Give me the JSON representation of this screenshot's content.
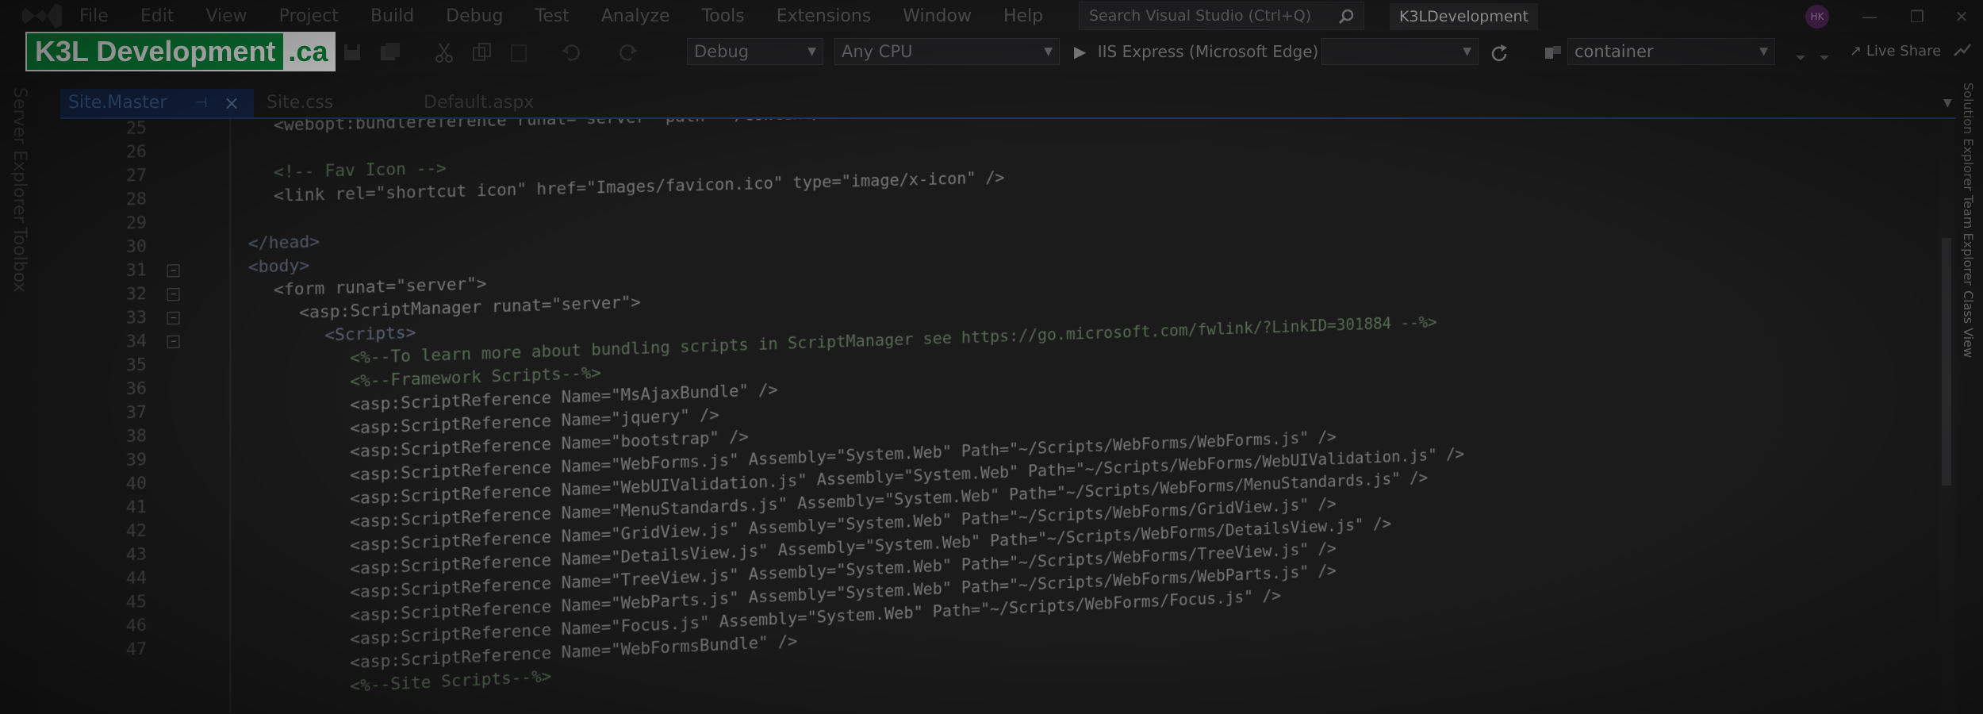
{
  "menu": [
    "File",
    "Edit",
    "View",
    "Project",
    "Build",
    "Debug",
    "Test",
    "Analyze",
    "Tools",
    "Extensions",
    "Window",
    "Help"
  ],
  "search": {
    "placeholder": "Search Visual Studio (Ctrl+Q)"
  },
  "project_title": "K3LDevelopment",
  "user_initials": "HK",
  "logo": {
    "main": "K3L Development",
    "tld": ".ca"
  },
  "toolbar": {
    "config": "Debug",
    "platform": "Any CPU",
    "run_target": "IIS Express (Microsoft Edge)",
    "nav_target": "container",
    "live_share": "Live Share"
  },
  "tabs": [
    {
      "label": "Site.Master",
      "active": true
    },
    {
      "label": "Site.css",
      "active": false
    },
    {
      "label": "Default.aspx",
      "active": false
    }
  ],
  "left_rail": [
    "Server Explorer",
    "Toolbox"
  ],
  "right_rail": [
    "Solution Explorer",
    "Team Explorer",
    "Class View"
  ],
  "code_lines": [
    {
      "n": "25",
      "indent": 2,
      "text": "<webopt:bundlereference runat=\"server\" path=\"~/Content/css\" />"
    },
    {
      "n": "26",
      "indent": 0,
      "text": ""
    },
    {
      "n": "27",
      "indent": 2,
      "text": "<!-- Fav Icon -->"
    },
    {
      "n": "28",
      "indent": 2,
      "text": "<link rel=\"shortcut icon\" href=\"Images/favicon.ico\" type=\"image/x-icon\" />"
    },
    {
      "n": "29",
      "indent": 0,
      "text": ""
    },
    {
      "n": "30",
      "indent": 0,
      "text": "</head>"
    },
    {
      "n": "31",
      "indent": 0,
      "text": "<body>"
    },
    {
      "n": "32",
      "indent": 2,
      "text": "<form runat=\"server\">"
    },
    {
      "n": "33",
      "indent": 4,
      "text": "<asp:ScriptManager runat=\"server\">"
    },
    {
      "n": "34",
      "indent": 6,
      "text": "<Scripts>"
    },
    {
      "n": "35",
      "indent": 8,
      "text": "<%--To learn more about bundling scripts in ScriptManager see https://go.microsoft.com/fwlink/?LinkID=301884 --%>"
    },
    {
      "n": "36",
      "indent": 8,
      "text": "<%--Framework Scripts--%>"
    },
    {
      "n": "37",
      "indent": 8,
      "text": "<asp:ScriptReference Name=\"MsAjaxBundle\" />"
    },
    {
      "n": "38",
      "indent": 8,
      "text": "<asp:ScriptReference Name=\"jquery\" />"
    },
    {
      "n": "39",
      "indent": 8,
      "text": "<asp:ScriptReference Name=\"bootstrap\" />"
    },
    {
      "n": "40",
      "indent": 8,
      "text": "<asp:ScriptReference Name=\"WebForms.js\" Assembly=\"System.Web\" Path=\"~/Scripts/WebForms/WebForms.js\" />"
    },
    {
      "n": "41",
      "indent": 8,
      "text": "<asp:ScriptReference Name=\"WebUIValidation.js\" Assembly=\"System.Web\" Path=\"~/Scripts/WebForms/WebUIValidation.js\" />"
    },
    {
      "n": "42",
      "indent": 8,
      "text": "<asp:ScriptReference Name=\"MenuStandards.js\" Assembly=\"System.Web\" Path=\"~/Scripts/WebForms/MenuStandards.js\" />"
    },
    {
      "n": "43",
      "indent": 8,
      "text": "<asp:ScriptReference Name=\"GridView.js\" Assembly=\"System.Web\" Path=\"~/Scripts/WebForms/GridView.js\" />"
    },
    {
      "n": "44",
      "indent": 8,
      "text": "<asp:ScriptReference Name=\"DetailsView.js\" Assembly=\"System.Web\" Path=\"~/Scripts/WebForms/DetailsView.js\" />"
    },
    {
      "n": "45",
      "indent": 8,
      "text": "<asp:ScriptReference Name=\"TreeView.js\" Assembly=\"System.Web\" Path=\"~/Scripts/WebForms/TreeView.js\" />"
    },
    {
      "n": "46",
      "indent": 8,
      "text": "<asp:ScriptReference Name=\"WebParts.js\" Assembly=\"System.Web\" Path=\"~/Scripts/WebForms/WebParts.js\" />"
    },
    {
      "n": "47",
      "indent": 8,
      "text": "<asp:ScriptReference Name=\"Focus.js\" Assembly=\"System.Web\" Path=\"~/Scripts/WebForms/Focus.js\" />"
    },
    {
      "n": "",
      "indent": 8,
      "text": "<asp:ScriptReference Name=\"WebFormsBundle\" />"
    },
    {
      "n": "",
      "indent": 8,
      "text": "<%--Site Scripts--%>"
    }
  ]
}
